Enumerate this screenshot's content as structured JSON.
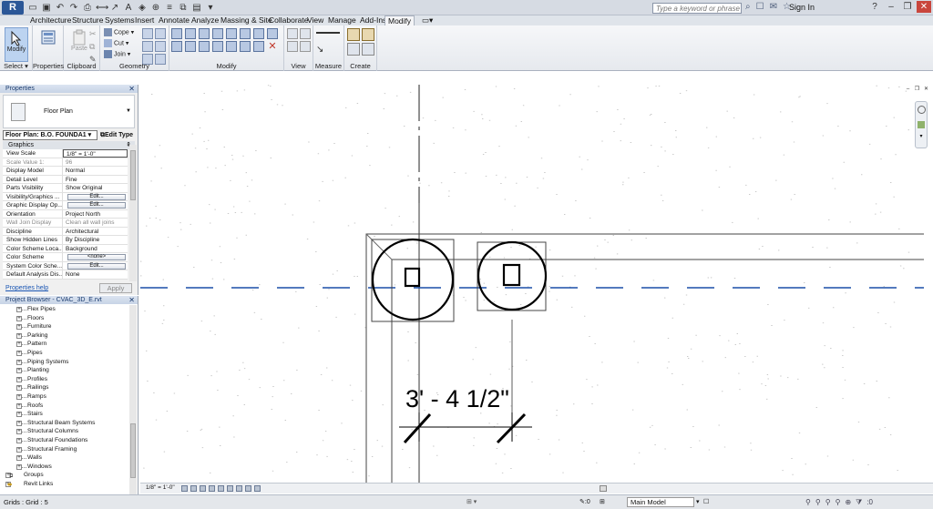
{
  "app": {
    "logo": "R"
  },
  "search": {
    "placeholder": "Type a keyword or phrase"
  },
  "account": {
    "signin_label": "Sign In"
  },
  "tabs": [
    "Architecture",
    "Structure",
    "Systems",
    "Insert",
    "Annotate",
    "Analyze",
    "Massing & Site",
    "Collaborate",
    "View",
    "Manage",
    "Add-Ins",
    "Modify"
  ],
  "active_tab": "Modify",
  "ribbon": {
    "select_label": "Select",
    "modify_label": "Modify",
    "properties_label": "Properties",
    "paste_label": "Paste",
    "clipboard_label": "Clipboard",
    "cope_label": "Cope",
    "cut_label": "Cut",
    "join_label": "Join",
    "geometry_label": "Geometry",
    "modify_panel_label": "Modify",
    "view_label": "View",
    "measure_label": "Measure",
    "create_label": "Create"
  },
  "properties": {
    "title": "Properties",
    "type_name": "Floor Plan",
    "instance_selector": "Floor Plan: B.O. FOUNDA1",
    "edit_type": "Edit Type",
    "group": "Graphics",
    "rows": [
      {
        "k": "View Scale",
        "v": "1/8\" = 1'-0\"",
        "boxed": true
      },
      {
        "k": "Scale Value    1:",
        "v": "96",
        "dim": true
      },
      {
        "k": "Display Model",
        "v": "Normal"
      },
      {
        "k": "Detail Level",
        "v": "Fine"
      },
      {
        "k": "Parts Visibility",
        "v": "Show Original"
      },
      {
        "k": "Visibility/Graphics ...",
        "btn": "Edit..."
      },
      {
        "k": "Graphic Display Op...",
        "btn": "Edit..."
      },
      {
        "k": "Orientation",
        "v": "Project North"
      },
      {
        "k": "Wall Join Display",
        "v": "Clean all wall joins",
        "dim": true
      },
      {
        "k": "Discipline",
        "v": "Architectural"
      },
      {
        "k": "Show Hidden Lines",
        "v": "By Discipline"
      },
      {
        "k": "Color Scheme Loca...",
        "v": "Background"
      },
      {
        "k": "Color Scheme",
        "btn": "<none>"
      },
      {
        "k": "System Color Sche...",
        "btn": "Edit..."
      },
      {
        "k": "Default Analysis Dis...",
        "v": "None"
      }
    ],
    "help_link": "Properties help",
    "apply_label": "Apply"
  },
  "browser": {
    "title": "Project Browser - CVAC_3D_E.rvt",
    "items": [
      "Flex Pipes",
      "Floors",
      "Furniture",
      "Parking",
      "Pattern",
      "Pipes",
      "Piping Systems",
      "Planting",
      "Profiles",
      "Railings",
      "Ramps",
      "Roofs",
      "Stairs",
      "Structural Beam Systems",
      "Structural Columns",
      "Structural Foundations",
      "Structural Framing",
      "Walls",
      "Windows"
    ],
    "top_items": [
      "Groups",
      "Revit Links"
    ]
  },
  "canvas": {
    "dimension_text": "3' - 4 1/2\""
  },
  "view_control": {
    "scale": "1/8\" = 1'-0\""
  },
  "status": {
    "message": "Grids : Grid : 5",
    "selection_count": ":0",
    "model": "Main Model",
    "filter_count": ":0"
  }
}
